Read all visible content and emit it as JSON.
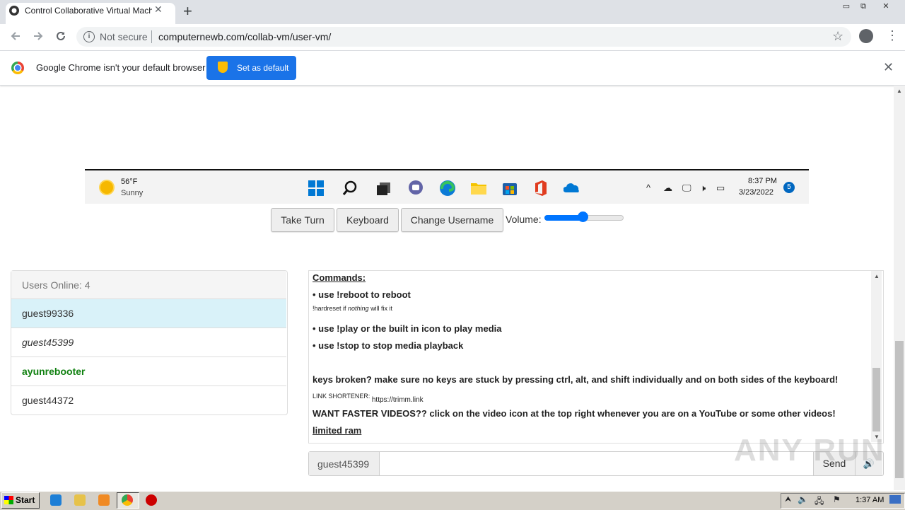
{
  "browser": {
    "tab_title": "Control Collaborative Virtual Machine",
    "new_tab": "+",
    "tab_close": "✕",
    "security": "Not secure",
    "url": "computernewb.com/collab-vm/user-vm/",
    "window_buttons": [
      "▭",
      "⧉",
      "✕"
    ]
  },
  "infobar": {
    "message": "Google Chrome isn't your default browser",
    "button": "Set as default",
    "close": "✕"
  },
  "vm": {
    "weather_temp": "56°F",
    "weather_desc": "Sunny",
    "clock_time": "8:37 PM",
    "clock_date": "3/23/2022",
    "notifications": "5",
    "taskbar_icons": [
      "windows-start-icon",
      "search-icon",
      "task-view-icon",
      "teams-chat-icon",
      "edge-icon",
      "file-explorer-icon",
      "store-icon",
      "office-icon",
      "onedrive-icon"
    ]
  },
  "controls": {
    "take_turn": "Take Turn",
    "keyboard": "Keyboard",
    "change_username": "Change Username",
    "volume_label": "Volume:",
    "volume_level": 0.5
  },
  "users": {
    "header": "Users Online: 4",
    "list": [
      {
        "name": "guest99336",
        "style": "highlighted"
      },
      {
        "name": "guest45399",
        "style": "italic"
      },
      {
        "name": "ayunrebooter",
        "style": "admin"
      },
      {
        "name": "guest44372",
        "style": "normal"
      }
    ]
  },
  "chat": {
    "commands_title": "Commands:",
    "line_reboot": "• use !reboot to reboot",
    "hardreset_pre": "!hardreset if ",
    "hardreset_em": "nothing",
    "hardreset_post": " will fix it",
    "line_play": "• use !play or the built in icon to play media",
    "line_stop": "• use !stop to stop media playback",
    "line_keys": "keys broken? make sure no keys are stuck by pressing ctrl, alt, and shift individually and on both sides of the keyboard!",
    "shortener_label": "LINK SHORTENER: ",
    "shortener_url": "https://trimm.link",
    "line_videos": "WANT FASTER VIDEOS?? click on the video icon at the top right whenever you are on a YouTube or some other videos!",
    "line_ram": "limited ram"
  },
  "chat_input": {
    "username": "guest45399",
    "send": "Send",
    "value": ""
  },
  "watermark": "ANY RUN",
  "os": {
    "start": "Start",
    "clock": "1:37 AM"
  },
  "colors": {
    "accent_blue": "#1a73e8",
    "highlight_row": "#d9f2f9",
    "admin_green": "#118111"
  }
}
